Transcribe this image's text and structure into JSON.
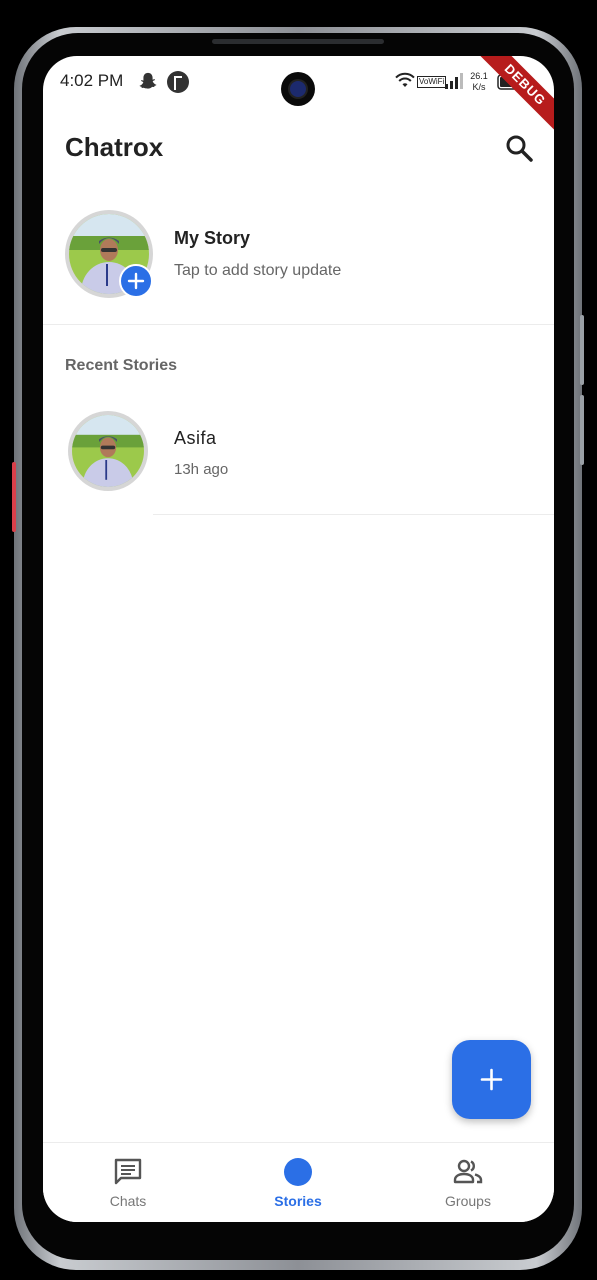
{
  "status_bar": {
    "time": "4:02 PM",
    "vowifi_label": "VoWiFi",
    "net_speed_value": "26.1",
    "net_speed_unit": "K/s",
    "icons": [
      "snapchat-icon",
      "app-notification-icon",
      "wifi-icon",
      "signal-icon",
      "battery-icon"
    ]
  },
  "debug_banner": "DEBUG",
  "header": {
    "title": "Chatrox",
    "search_icon": "search-icon"
  },
  "my_story": {
    "name": "My Story",
    "subtitle": "Tap to add story update",
    "add_icon": "plus-icon"
  },
  "recent_stories": {
    "section_label": "Recent Stories",
    "items": [
      {
        "name": "Asifa",
        "time": "13h ago"
      }
    ]
  },
  "fab": {
    "icon": "plus-icon"
  },
  "bottom_nav": {
    "items": [
      {
        "label": "Chats",
        "icon": "chat-icon",
        "active": false
      },
      {
        "label": "Stories",
        "icon": "stories-icon",
        "active": true
      },
      {
        "label": "Groups",
        "icon": "groups-icon",
        "active": false
      }
    ]
  },
  "colors": {
    "accent": "#2b6fe6",
    "debug_ribbon": "#b71c1c",
    "text_primary": "#222222",
    "text_secondary": "#666666"
  }
}
